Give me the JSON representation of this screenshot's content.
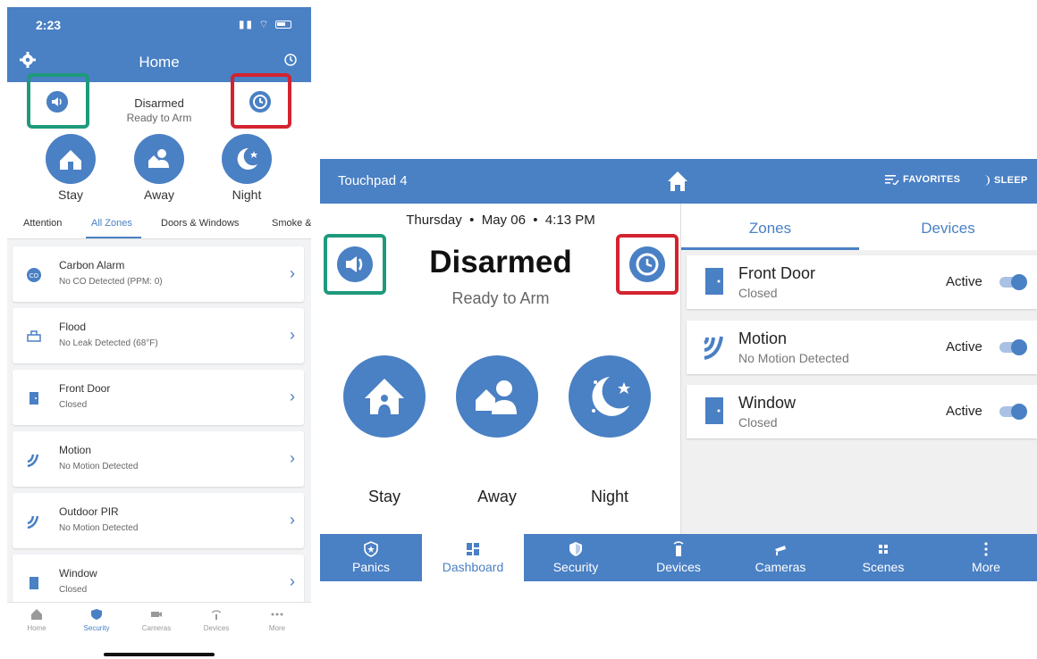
{
  "phone": {
    "time": "2:23",
    "header": {
      "title": "Home"
    },
    "summary": {
      "state": "Disarmed",
      "sub": "Ready to Arm"
    },
    "modes": [
      {
        "label": "Stay",
        "icon": "stay-house-icon"
      },
      {
        "label": "Away",
        "icon": "away-people-icon"
      },
      {
        "label": "Night",
        "icon": "night-moon-icon"
      }
    ],
    "tabs": [
      "Attention",
      "All Zones",
      "Doors & Windows",
      "Smoke &"
    ],
    "zones": [
      {
        "name": "Carbon Alarm",
        "status": "No CO Detected (PPM: 0)",
        "icon": "carbon-alarm-icon"
      },
      {
        "name": "Flood",
        "status": "No Leak Detected (68°F)",
        "icon": "flood-icon"
      },
      {
        "name": "Front Door",
        "status": "Closed",
        "icon": "door-icon"
      },
      {
        "name": "Motion",
        "status": "No Motion Detected",
        "icon": "motion-icon"
      },
      {
        "name": "Outdoor PIR",
        "status": "No Motion Detected",
        "icon": "motion-icon"
      },
      {
        "name": "Window",
        "status": "Closed",
        "icon": "window-icon"
      }
    ],
    "bottom_nav": [
      "Home",
      "Security",
      "Cameras",
      "Devices",
      "More"
    ]
  },
  "tablet": {
    "header": {
      "title": "Touchpad 4",
      "favorites": "FAVORITES",
      "sleep": "SLEEP"
    },
    "date": {
      "day": "Thursday",
      "date": "May 06",
      "time": "4:13 PM"
    },
    "state": "Disarmed",
    "sub": "Ready to Arm",
    "modes": [
      {
        "label": "Stay"
      },
      {
        "label": "Away"
      },
      {
        "label": "Night"
      }
    ],
    "tabs": [
      "Zones",
      "Devices"
    ],
    "zones": [
      {
        "name": "Front Door",
        "status": "Closed",
        "active": "Active",
        "icon": "door-icon"
      },
      {
        "name": "Motion",
        "status": "No Motion Detected",
        "active": "Active",
        "icon": "motion-icon"
      },
      {
        "name": "Window",
        "status": "Closed",
        "active": "Active",
        "icon": "window-icon"
      }
    ],
    "bottom_nav": [
      "Panics",
      "Dashboard",
      "Security",
      "Devices",
      "Cameras",
      "Scenes",
      "More"
    ]
  },
  "colors": {
    "brand": "#4a80c4",
    "highlight_green": "#1e9a7b",
    "highlight_red": "#d32330"
  }
}
